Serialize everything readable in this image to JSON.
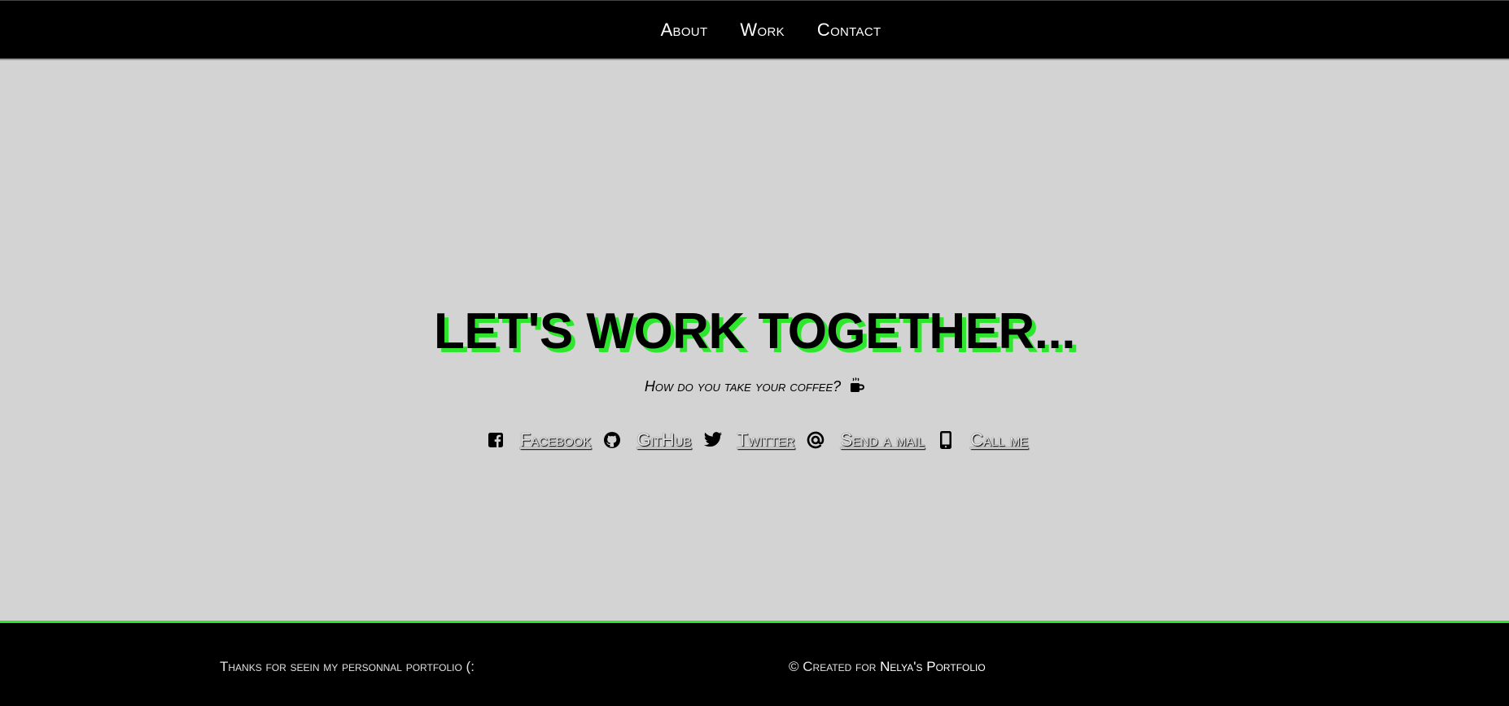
{
  "nav": {
    "items": [
      {
        "label": "About"
      },
      {
        "label": "Work"
      },
      {
        "label": "Contact"
      }
    ]
  },
  "hero": {
    "title": "LET'S WORK TOGETHER...",
    "subtitle": "How do you take your coffee?",
    "subtitle_icon": "coffee-icon"
  },
  "socials": [
    {
      "icon": "facebook-icon",
      "label": "Facebook"
    },
    {
      "icon": "github-icon",
      "label": "GitHub"
    },
    {
      "icon": "twitter-icon",
      "label": "Twitter"
    },
    {
      "icon": "at-icon",
      "label": "Send a mail"
    },
    {
      "icon": "mobile-phone-icon",
      "label": "Call me"
    }
  ],
  "footer": {
    "thanks": "Thanks for seein my personnal portfolio (:",
    "created_prefix": "© Created for",
    "brand": "Nelya's Portfolio"
  },
  "colors": {
    "accent": "#2ee62e",
    "background": "#d3d3d3",
    "bar": "#000000"
  }
}
